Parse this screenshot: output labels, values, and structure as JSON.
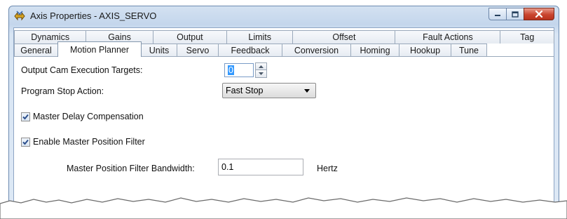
{
  "window": {
    "title": "Axis Properties - AXIS_SERVO"
  },
  "tabs": {
    "back_row": [
      {
        "label": "Dynamics"
      },
      {
        "label": "Gains"
      },
      {
        "label": "Output"
      },
      {
        "label": "Limits"
      },
      {
        "label": "Offset"
      },
      {
        "label": "Fault Actions"
      },
      {
        "label": "Tag"
      }
    ],
    "front_row": [
      {
        "label": "General"
      },
      {
        "label": "Motion Planner",
        "active": true
      },
      {
        "label": "Units"
      },
      {
        "label": "Servo"
      },
      {
        "label": "Feedback"
      },
      {
        "label": "Conversion"
      },
      {
        "label": "Homing"
      },
      {
        "label": "Hookup"
      },
      {
        "label": "Tune"
      }
    ]
  },
  "form": {
    "output_cam_label": "Output Cam Execution Targets:",
    "output_cam_value": "0",
    "program_stop_label": "Program Stop Action:",
    "program_stop_value": "Fast Stop",
    "master_delay_label": "Master Delay Compensation",
    "master_delay_checked": true,
    "enable_filter_label": "Enable Master Position Filter",
    "enable_filter_checked": true,
    "filter_bandwidth_label": "Master Position Filter Bandwidth:",
    "filter_bandwidth_value": "0.1",
    "filter_bandwidth_unit": "Hertz"
  },
  "colors": {
    "titlebar": "#c4d6ec",
    "close_button": "#c9452f",
    "selection": "#3399ff",
    "check_mark": "#2b4e8c"
  },
  "icons": {
    "app": "axis-properties-icon",
    "minimize": "minimize-icon",
    "maximize": "maximize-icon",
    "close": "close-icon"
  }
}
